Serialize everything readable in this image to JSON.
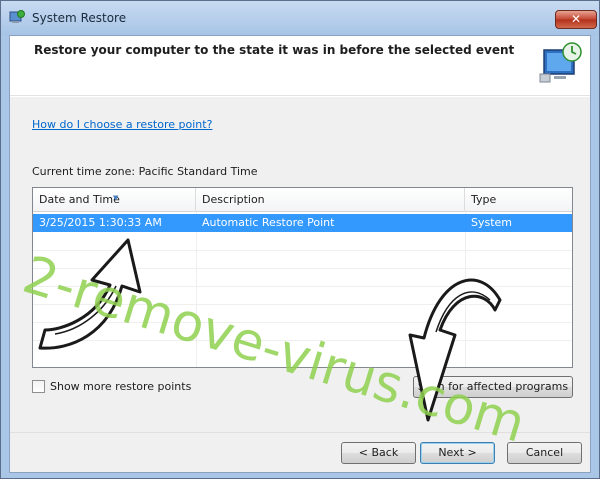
{
  "window": {
    "title": "System Restore",
    "close_label": "✕"
  },
  "header": {
    "text": "Restore your computer to the state it was in before the selected event",
    "icon": "system-restore-monitor-icon"
  },
  "help_link": "How do I choose a restore point?",
  "timezone_label": "Current time zone: Pacific Standard Time",
  "table": {
    "columns": [
      "Date and Time",
      "Description",
      "Type"
    ],
    "rows": [
      {
        "date": "3/25/2015 1:30:33 AM",
        "description": "Automatic Restore Point",
        "type": "System",
        "selected": true
      }
    ]
  },
  "show_more_label": "Show more restore points",
  "affected_programs_label": "Scan for affected programs",
  "buttons": {
    "back": "< Back",
    "next": "Next >",
    "cancel": "Cancel"
  },
  "watermark": "2-remove-virus.com",
  "colors": {
    "selection": "#3399ff",
    "link": "#0066cc",
    "watermark": "#8fd14f"
  }
}
